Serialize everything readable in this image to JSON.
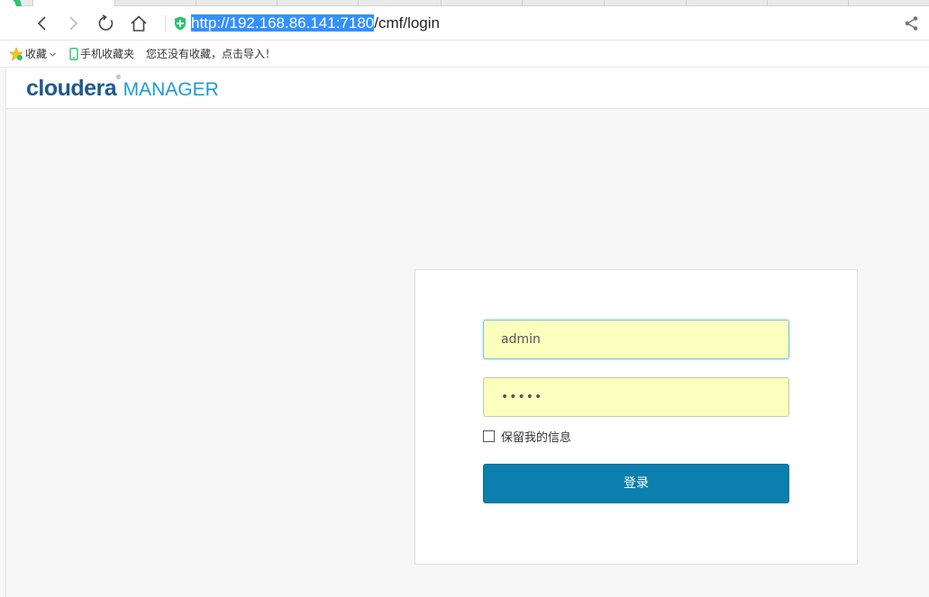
{
  "browser": {
    "url_selected": "http://192.168.86.141:7180",
    "url_rest": "/cmf/login",
    "bookmarks": {
      "favorites_label": "收藏",
      "mobile_label": "手机收藏夹",
      "import_hint": "您还没有收藏，点击导入！"
    }
  },
  "app": {
    "brand_main": "cloudera",
    "brand_trademark": "®",
    "brand_sub": "MANAGER"
  },
  "login": {
    "username_value": "admin",
    "password_mask": "•••••",
    "remember_label": "保留我的信息",
    "submit_label": "登录"
  },
  "colors": {
    "accent": "#0b7fad",
    "autofill": "#fbffbd",
    "brand_dark": "#1e5b8a",
    "brand_light": "#1d9ad6"
  }
}
